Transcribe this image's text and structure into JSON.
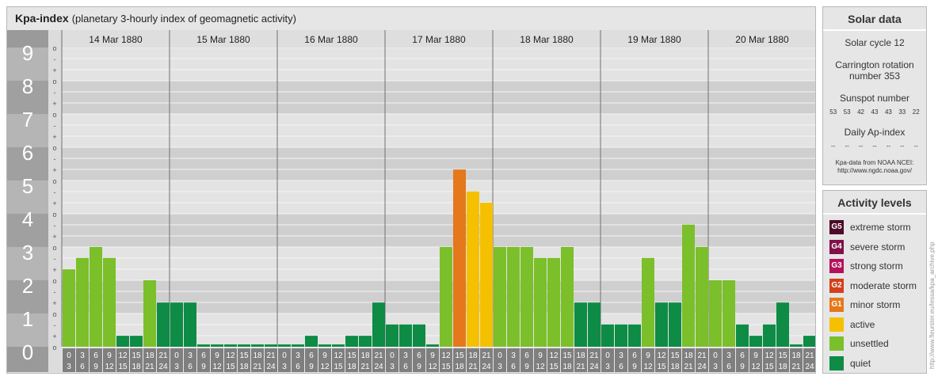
{
  "header": {
    "title": "Kpa-index",
    "subtitle": "(planetary 3-hourly index of geomagnetic activity)"
  },
  "chart_data": {
    "type": "bar",
    "title": "Kpa-index",
    "subtitle": "(planetary 3-hourly index of geomagnetic activity)",
    "ylim": [
      0,
      9
    ],
    "y_ticks": [
      "0",
      "1",
      "2",
      "3",
      "4",
      "5",
      "6",
      "7",
      "8",
      "9"
    ],
    "minor_marks": [
      "o",
      "+",
      "-",
      "o",
      "+",
      "-",
      "o",
      "+",
      "-",
      "o",
      "+",
      "-",
      "o",
      "+",
      "-",
      "o",
      "+",
      "-",
      "o",
      "+",
      "-",
      "o",
      "+",
      "-",
      "o",
      "+",
      "-",
      "o"
    ],
    "days": [
      "14 Mar 1880",
      "15 Mar 1880",
      "16 Mar 1880",
      "17 Mar 1880",
      "18 Mar 1880",
      "19 Mar 1880",
      "20 Mar 1880"
    ],
    "interval_start": [
      "0",
      "3",
      "6",
      "9",
      "12",
      "15",
      "18",
      "21"
    ],
    "interval_end": [
      "3",
      "6",
      "9",
      "12",
      "15",
      "18",
      "21",
      "24"
    ],
    "values": [
      2.33,
      2.67,
      3.0,
      2.67,
      0.33,
      0.33,
      2.0,
      1.33,
      1.33,
      1.33,
      0.0,
      0.0,
      0.0,
      0.0,
      0.0,
      0.0,
      0.0,
      0.0,
      0.33,
      0.0,
      0.0,
      0.33,
      0.33,
      1.33,
      0.67,
      0.67,
      0.67,
      0.0,
      3.0,
      5.33,
      4.67,
      4.33,
      3.0,
      3.0,
      3.0,
      2.67,
      2.67,
      3.0,
      1.33,
      1.33,
      0.67,
      0.67,
      0.67,
      2.67,
      1.33,
      1.33,
      3.67,
      3.0,
      2.0,
      2.0,
      0.67,
      0.33,
      0.67,
      1.33,
      0.0,
      0.33
    ],
    "colors": {
      "quiet": "#0e8b45",
      "unsettled": "#7bbf2a",
      "active": "#f5c000",
      "minor_storm": "#e5781a",
      "moderate_storm": "#d33f1a",
      "strong_storm": "#b4115c",
      "severe_storm": "#82104a",
      "extreme_storm": "#4d0a2a"
    },
    "grid": true
  },
  "solar": {
    "title": "Solar data",
    "cycle": "Solar cycle 12",
    "carrington_1": "Carrington rotation",
    "carrington_2": "number 353",
    "sunspot_title": "Sunspot number",
    "sunspots": [
      "53",
      "53",
      "42",
      "43",
      "43",
      "33",
      "22"
    ],
    "ap_title": "Daily Ap-index",
    "ap_values": [
      "--",
      "--",
      "--",
      "--",
      "--",
      "--",
      "--"
    ],
    "source_1": "Kpa-data from NOAA NCEI:",
    "source_2": "http://www.ngdc.noaa.gov/"
  },
  "activity": {
    "title": "Activity levels",
    "levels": [
      {
        "code": "G5",
        "label": "extreme storm",
        "color": "#4d0a2a"
      },
      {
        "code": "G4",
        "label": "severe storm",
        "color": "#82104a"
      },
      {
        "code": "G3",
        "label": "strong storm",
        "color": "#b4115c"
      },
      {
        "code": "G2",
        "label": "moderate storm",
        "color": "#d33f1a"
      },
      {
        "code": "G1",
        "label": "minor storm",
        "color": "#e5781a"
      },
      {
        "code": "",
        "label": "active",
        "color": "#f5c000"
      },
      {
        "code": "",
        "label": "unsettled",
        "color": "#7bbf2a"
      },
      {
        "code": "",
        "label": "quiet",
        "color": "#0e8b45"
      }
    ]
  },
  "watermark": "http://www.fleurster.eu/lessa/kpa_archive.php"
}
